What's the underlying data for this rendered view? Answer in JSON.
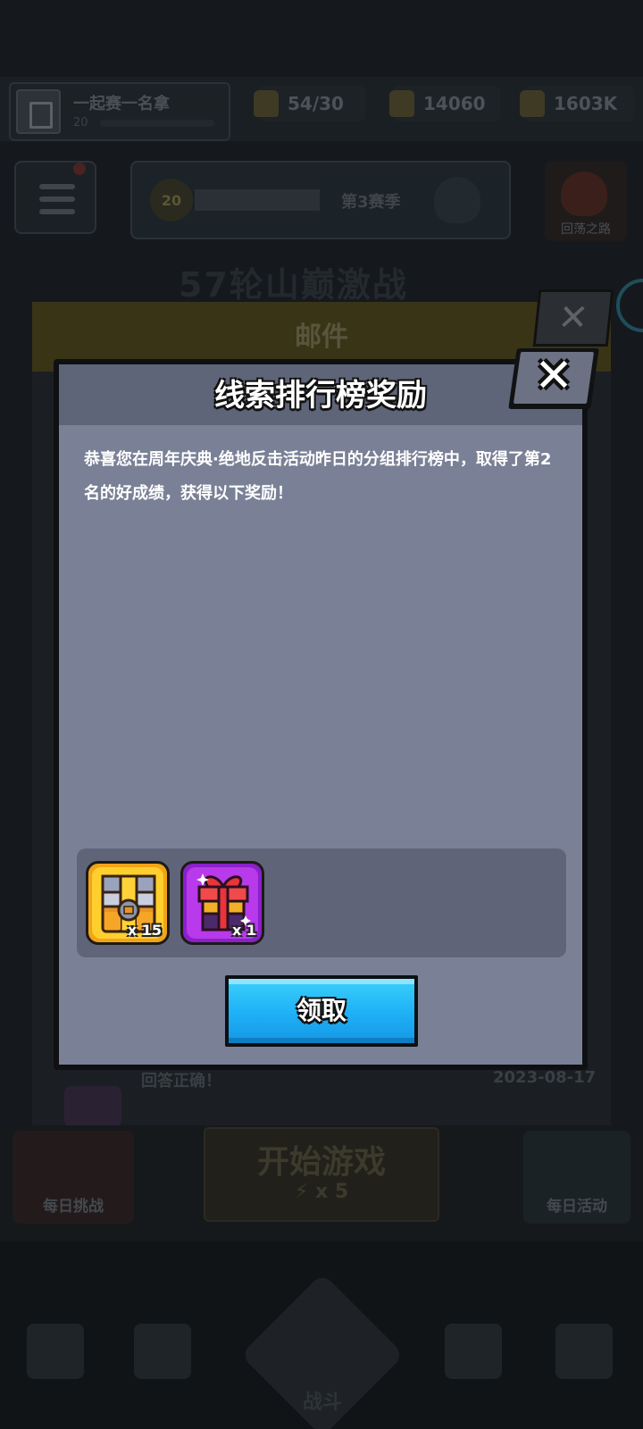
{
  "background": {
    "player": {
      "name": "一起赛一名拿",
      "level": "20"
    },
    "resources": [
      {
        "name": "energy",
        "value": "54/30",
        "icon": "energy-icon"
      },
      {
        "name": "coins",
        "value": "14060",
        "icon": "coin-icon"
      },
      {
        "name": "power",
        "value": "1603K",
        "icon": "trophy-icon"
      }
    ],
    "season": {
      "level": "20",
      "progress": "5263/6000",
      "label": "第3赛季"
    },
    "map_label": "回荡之路",
    "event_title": "57轮山巅激战",
    "mail": {
      "title": "邮件",
      "row_text": "回答正确！",
      "row_date": "2023-08-17"
    },
    "bottom": {
      "left_label": "每日挑战",
      "start_label": "开始游戏",
      "start_sub": "⚡ x 5",
      "right_label": "每日活动"
    },
    "nav": {
      "center_label": "战斗"
    }
  },
  "dialog": {
    "title": "线索排行榜奖励",
    "close_glyph": "✕",
    "message": "恭喜您在周年庆典·绝地反击活动昨日的分组排行榜中，取得了第2名的好成绩，获得以下奖励！",
    "rewards": [
      {
        "name": "gold-chest",
        "icon": "chest-icon",
        "qty": "x 15",
        "color": "#f2a416"
      },
      {
        "name": "purple-gift",
        "icon": "gift-icon",
        "qty": "x 1",
        "color": "#b83aea"
      }
    ],
    "claim_label": "领取"
  }
}
